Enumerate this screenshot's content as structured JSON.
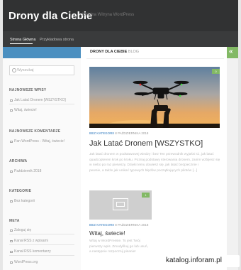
{
  "header": {
    "site_title": "Drony dla Ciebie",
    "tagline": "Kolejna Witryna WordPress"
  },
  "nav": {
    "items": [
      {
        "label": "Strona Główna"
      },
      {
        "label": "Przykładowa strona"
      }
    ]
  },
  "sidebar": {
    "search_placeholder": "Wyszukaj",
    "widgets": [
      {
        "heading": "NAJNOWSZE WPISY",
        "items": [
          "Jak Latać Dronem [WSZYSTKO]",
          "Witaj, świecie!"
        ]
      },
      {
        "heading": "NAJNOWSZE KOMENTARZE",
        "items": [
          "Pan WordPress - Witaj, świecie!"
        ]
      },
      {
        "heading": "ARCHIWA",
        "items": [
          "Październik 2018"
        ]
      },
      {
        "heading": "KATEGORIE",
        "items": [
          "Bez kategorii"
        ]
      },
      {
        "heading": "META",
        "items": [
          "Zaloguj się",
          "Kanał RSS z wpisami",
          "Kanał RSS komentarzy",
          "WordPress.org"
        ]
      }
    ]
  },
  "main": {
    "breadcrumb_site": "DRONY DLA CIEBIE",
    "breadcrumb_section": "BLOG",
    "posts": [
      {
        "badge": "0",
        "category": "BEZ KATEGORII",
        "date": "8 PAŹDZIERNIKA 2018",
        "title": "Jak Latać Dronem [WSZYSTKO]",
        "excerpt_lines": [
          "Jak latać dronem w podstawowej wiedzy i bez Ten przewodnik wyjaśni Ci, jak latać",
          "quadcopterem krok po kroku. Poznaj podstawy sterowania dronem, zanim wzbijesz się",
          "w niebo po raz pierwszy. Dzięki temu dowiesz się, jak latać bezpiecznie i",
          "pewnie, a także jak unikać typowych błędów początkujących pilotów [...]"
        ]
      },
      {
        "badge": "1",
        "category": "BEZ KATEGORII",
        "date": "8 PAŹDZIERNIKA 2018",
        "title": "Witaj, świecie!",
        "excerpt_lines": [
          "Witaj w WordPressie. To jest Twój",
          "pierwszy wpis. Zmodyfikuj go lub usuń,",
          "a następnie rozpocznij pisanie!"
        ]
      }
    ]
  },
  "watermark": "katalog.inforam.pl",
  "colors": {
    "header_bg": "#313233",
    "accent_blue": "#4b8fc0",
    "accent_green": "#82b965",
    "category_blue": "#6a9fd0"
  }
}
